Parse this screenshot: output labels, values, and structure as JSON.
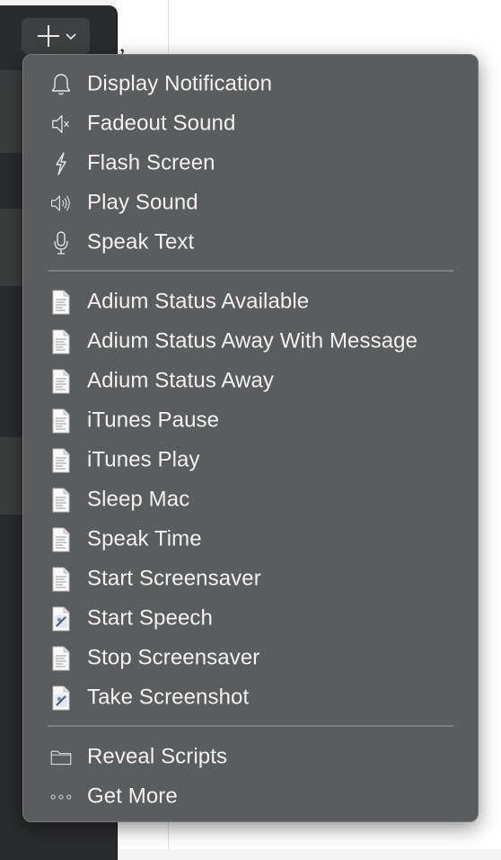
{
  "menu": {
    "actions": [
      {
        "label": "Display Notification",
        "icon": "bell-icon"
      },
      {
        "label": "Fadeout Sound",
        "icon": "speaker-mute-icon"
      },
      {
        "label": "Flash Screen",
        "icon": "lightning-icon"
      },
      {
        "label": "Play Sound",
        "icon": "speaker-wave-icon"
      },
      {
        "label": "Speak Text",
        "icon": "microphone-icon"
      }
    ],
    "scripts": [
      {
        "label": "Adium Status Available",
        "icon": "script-document-icon"
      },
      {
        "label": "Adium Status Away With Message",
        "icon": "script-document-icon"
      },
      {
        "label": "Adium Status Away",
        "icon": "script-document-icon"
      },
      {
        "label": "iTunes Pause",
        "icon": "script-document-icon"
      },
      {
        "label": "iTunes Play",
        "icon": "script-document-icon"
      },
      {
        "label": "Sleep Mac",
        "icon": "script-document-icon"
      },
      {
        "label": "Speak Time",
        "icon": "script-document-icon"
      },
      {
        "label": "Start Screensaver",
        "icon": "script-document-icon"
      },
      {
        "label": "Start Speech",
        "icon": "applescript-document-icon"
      },
      {
        "label": "Stop Screensaver",
        "icon": "script-document-icon"
      },
      {
        "label": "Take Screenshot",
        "icon": "applescript-document-icon"
      }
    ],
    "footer": [
      {
        "label": "Reveal Scripts",
        "icon": "folder-icon"
      },
      {
        "label": "Get More",
        "icon": "ellipsis-icon"
      }
    ]
  },
  "add_button": {
    "icon": "plus-icon",
    "chevron": "chevron-down-icon"
  },
  "document": {
    "visible_text": ","
  },
  "colors": {
    "menu_bg": "#5a5c5d",
    "menu_text": "#f2f2f2",
    "sidebar_bg": "#2a2b2c"
  }
}
